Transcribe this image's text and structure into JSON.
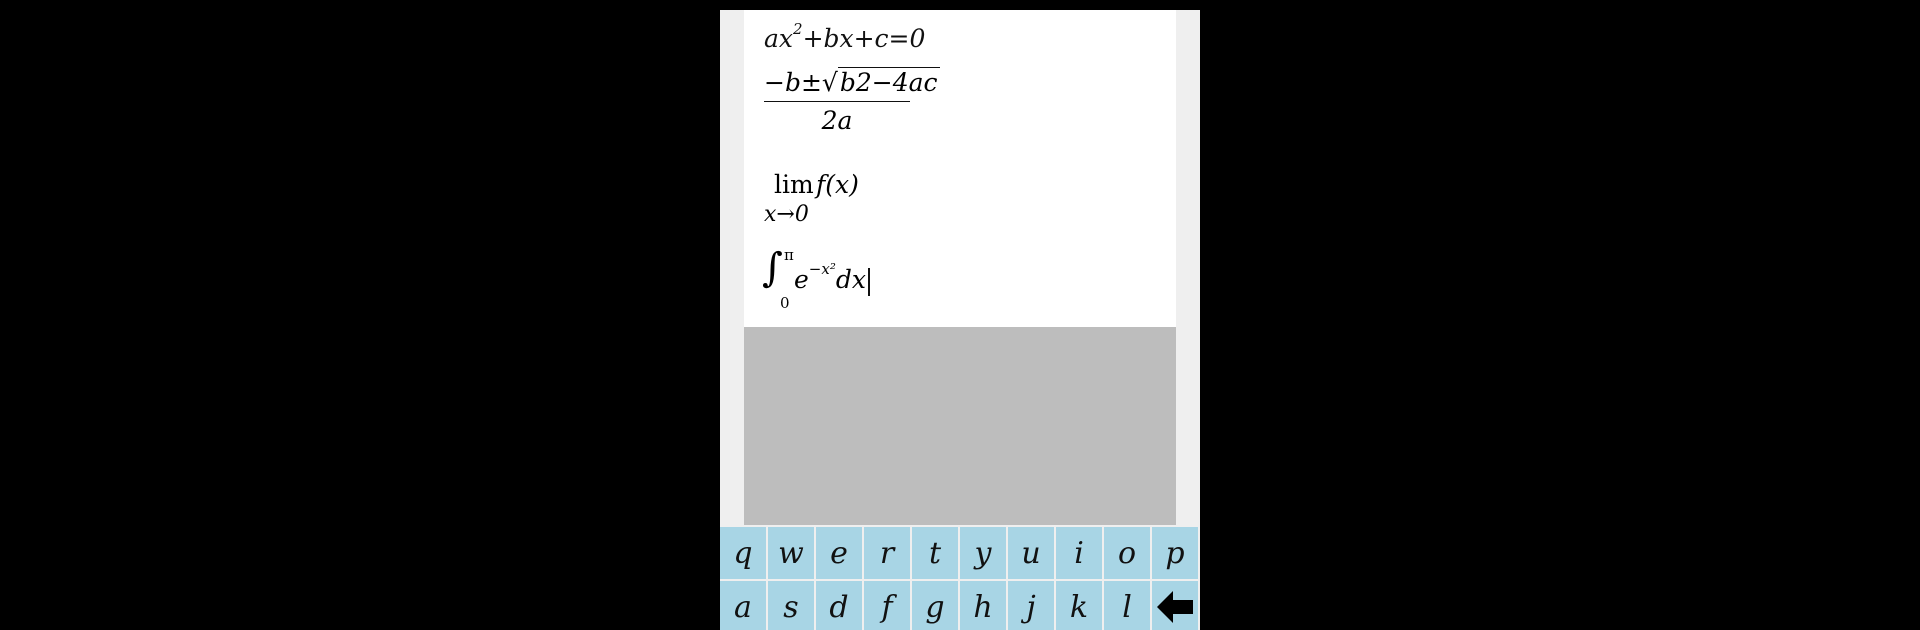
{
  "equations": {
    "quadratic": {
      "a": "ax",
      "sq": "2",
      "rest": "+bx+c=0"
    },
    "formula": {
      "num_pre": "−b±√",
      "rad_b": "b",
      "rad_sq": "2",
      "rad_rest": "−4ac",
      "den": "2a"
    },
    "limit": {
      "word": "lim",
      "fx": "f(x)",
      "sub": "x→0"
    },
    "integral": {
      "sign": "∫",
      "upper": "π",
      "lower": "0",
      "base": "e",
      "exp": "−x²",
      "dx": "dx"
    }
  },
  "keyboard": {
    "row1": [
      "q",
      "w",
      "e",
      "r",
      "t",
      "y",
      "u",
      "i",
      "o",
      "p"
    ],
    "row2": [
      "a",
      "s",
      "d",
      "f",
      "g",
      "h",
      "j",
      "k",
      "l"
    ]
  },
  "icons": {
    "backspace": "backspace-arrow-icon"
  }
}
